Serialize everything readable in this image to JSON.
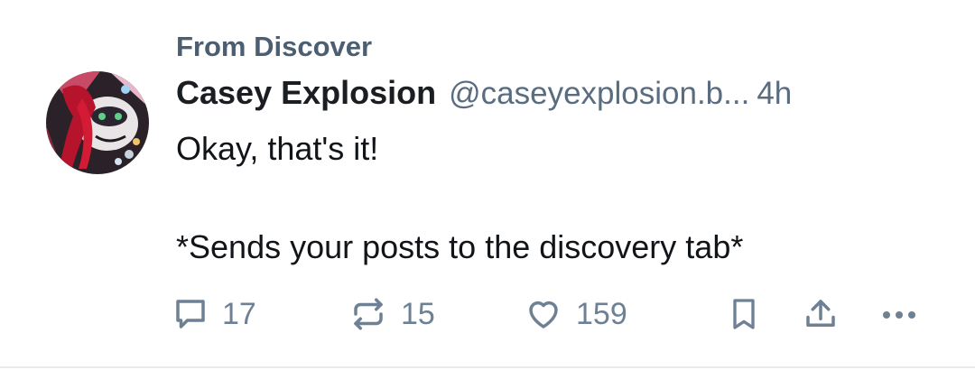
{
  "context": {
    "label": "From Discover"
  },
  "post": {
    "author_name": "Casey Explosion",
    "author_handle": "@caseyexplosion.b...",
    "timestamp": "4h",
    "text_line1": "Okay, that's it!",
    "text_line2": "*Sends your posts to the discovery tab*"
  },
  "actions": {
    "reply_count": "17",
    "repost_count": "15",
    "like_count": "159"
  },
  "icons": {
    "reply": "speech-bubble-icon",
    "repost": "repost-arrows-icon",
    "like": "heart-icon",
    "bookmark": "bookmark-icon",
    "share": "share-icon",
    "more": "more-dots-icon"
  },
  "colors": {
    "context_text": "#4b5e72",
    "meta_text": "#5a6c7f",
    "icon": "#6e8093"
  }
}
